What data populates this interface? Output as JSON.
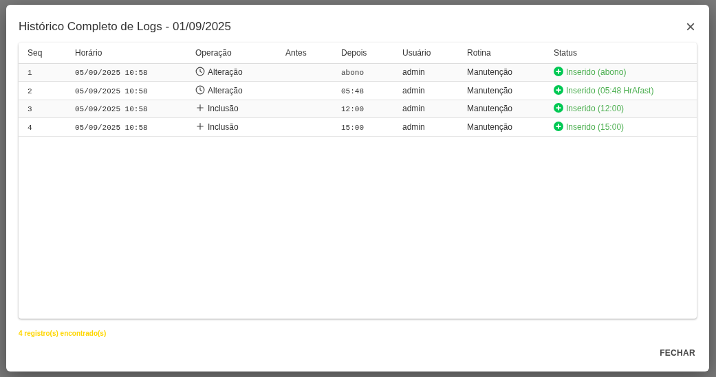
{
  "dialog": {
    "title": "Histórico Completo de Logs - 01/09/2025",
    "close": "×"
  },
  "table": {
    "columns": [
      "Seq",
      "Horário",
      "Operação",
      "Antes",
      "Depois",
      "Usuário",
      "Rotina",
      "Status"
    ],
    "rows": [
      {
        "seq": "1",
        "time": "05/09/2025 10:58",
        "operation": {
          "kind": "edit",
          "label": "Alteração"
        },
        "before": "",
        "after": "abono",
        "user": "admin",
        "routine": "Manutenção",
        "status": "Inserido (abono)"
      },
      {
        "seq": "2",
        "time": "05/09/2025 10:58",
        "operation": {
          "kind": "edit",
          "label": "Alteração"
        },
        "before": "",
        "after": "05:48",
        "user": "admin",
        "routine": "Manutenção",
        "status": "Inserido (05:48 HrAfast)"
      },
      {
        "seq": "3",
        "time": "05/09/2025 10:58",
        "operation": {
          "kind": "add",
          "label": "Inclusão"
        },
        "before": "",
        "after": "12:00",
        "user": "admin",
        "routine": "Manutenção",
        "status": "Inserido (12:00)"
      },
      {
        "seq": "4",
        "time": "05/09/2025 10:58",
        "operation": {
          "kind": "add",
          "label": "Inclusão"
        },
        "before": "",
        "after": "15:00",
        "user": "admin",
        "routine": "Manutenção",
        "status": "Inserido (15:00)"
      }
    ]
  },
  "record_count": "4 registro(s) encontrado(s)",
  "buttons": [
    "FECHAR"
  ]
}
